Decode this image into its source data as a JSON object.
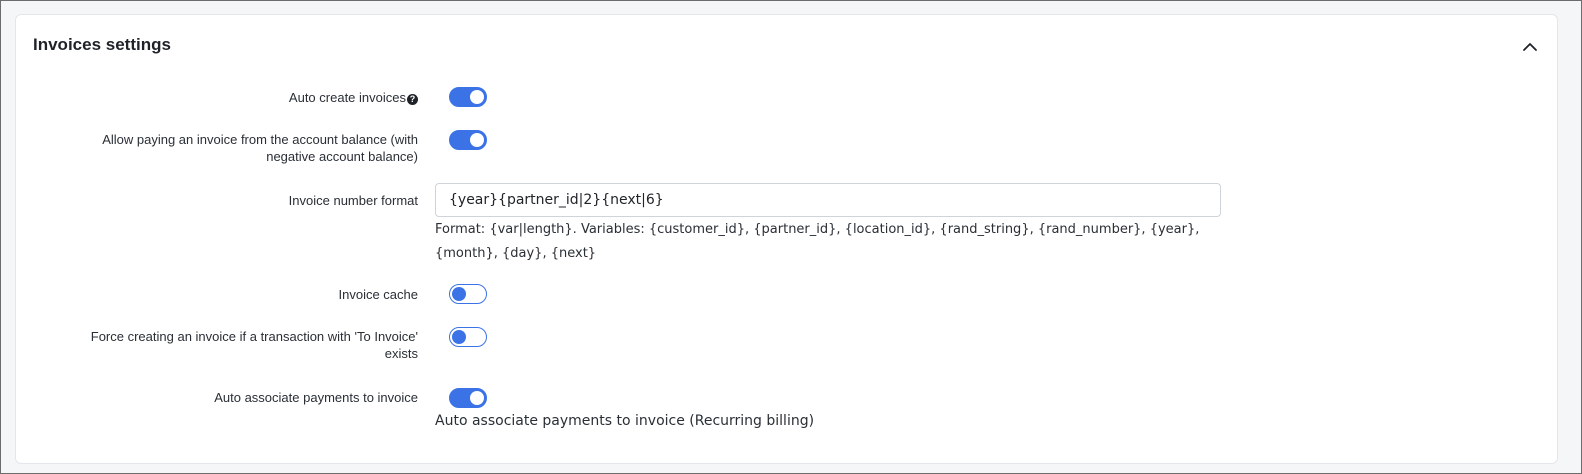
{
  "section": {
    "title": "Invoices settings",
    "collapse_icon": "chevron-up-icon"
  },
  "settings": {
    "auto_create": {
      "label": "Auto create invoices",
      "help_icon": "question-circle-icon",
      "enabled": true
    },
    "allow_paying_balance": {
      "label": "Allow paying an invoice from the account balance (with negative account balance)",
      "enabled": true
    },
    "invoice_number_format": {
      "label": "Invoice number format",
      "value": "{year}{partner_id|2}{next|6}",
      "hint": "Format: {var|length}. Variables: {customer_id}, {partner_id}, {location_id}, {rand_string}, {rand_number}, {year}, {month}, {day}, {next}"
    },
    "invoice_cache": {
      "label": "Invoice cache",
      "enabled": false
    },
    "force_creating": {
      "label": "Force creating an invoice if a transaction with 'To Invoice' exists",
      "enabled": false
    },
    "auto_associate_payments": {
      "label": "Auto associate payments to invoice",
      "enabled": true,
      "hint": "Auto associate payments to invoice (Recurring billing)"
    }
  },
  "colors": {
    "accent": "#3b73e6",
    "text": "#212529",
    "border": "#ced4da"
  }
}
